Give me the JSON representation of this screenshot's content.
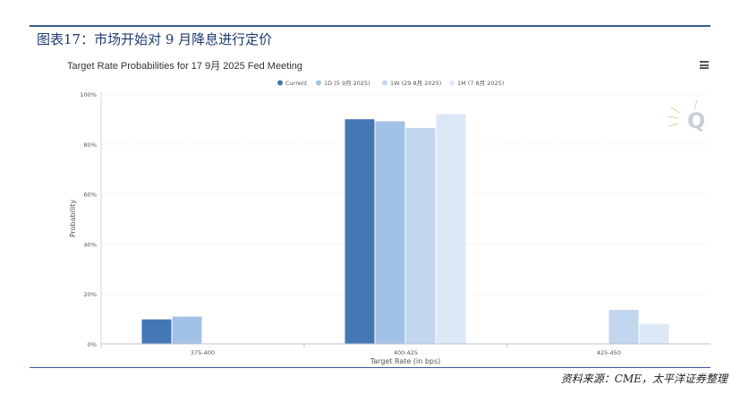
{
  "header": {
    "figure_title": "图表17：市场开始对 9 月降息进行定价",
    "source": "资料来源：CME，太平洋证券整理"
  },
  "chart_data": {
    "type": "bar",
    "title": "Target Rate Probabilities for 17 9月 2025 Fed Meeting",
    "xlabel": "Target Rate (in bps)",
    "ylabel": "Probability",
    "categories": [
      "375-400",
      "400-425",
      "425-450"
    ],
    "ylim": [
      0,
      100
    ],
    "yticks": [
      "0%",
      "20%",
      "40%",
      "60%",
      "80%",
      "100%"
    ],
    "grid": true,
    "legend_position": "top-center",
    "series": [
      {
        "name": "Current",
        "color": "#4677b5",
        "values": [
          9.8,
          89.9,
          0
        ]
      },
      {
        "name": "1D (5 9月 2025)",
        "color": "#a2c1e6",
        "values": [
          10.9,
          89.1,
          0
        ]
      },
      {
        "name": "1W (29 8月 2025)",
        "color": "#c2d6ee",
        "values": [
          0,
          86.4,
          13.6
        ]
      },
      {
        "name": "1M (7 8月 2025)",
        "color": "#dce8f6",
        "values": [
          0,
          92.0,
          8.0
        ]
      }
    ]
  },
  "icons": {
    "menu": "hamburger-menu-icon",
    "watermark": "q-logo-watermark"
  }
}
